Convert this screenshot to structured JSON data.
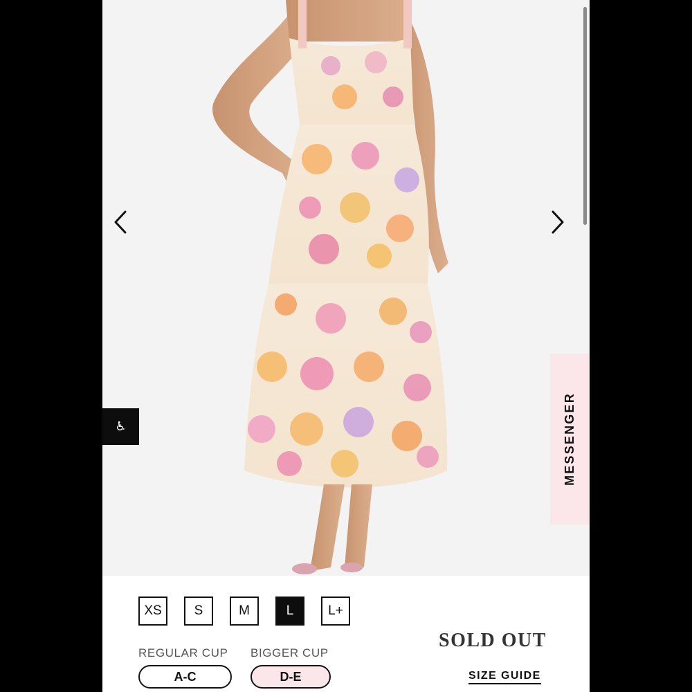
{
  "gallery": {
    "image_alt": "Floral midi dress",
    "prev_icon": "chevron-left-icon",
    "next_icon": "chevron-right-icon"
  },
  "accessibility": {
    "icon": "wheelchair-icon",
    "glyph": "♿"
  },
  "messenger": {
    "label": "MESSENGER"
  },
  "sizes": [
    {
      "label": "XS",
      "selected": false
    },
    {
      "label": "S",
      "selected": false
    },
    {
      "label": "M",
      "selected": false
    },
    {
      "label": "L",
      "selected": true
    },
    {
      "label": "L+",
      "selected": false
    }
  ],
  "cups": [
    {
      "heading": "REGULAR CUP",
      "value": "A-C",
      "selected": false
    },
    {
      "heading": "BIGGER CUP",
      "value": "D-E",
      "selected": true
    }
  ],
  "status": {
    "sold_out": "SOLD OUT",
    "size_guide": "SIZE GUIDE"
  },
  "colors": {
    "page_background": "#000000",
    "photo_background": "#f3f3f4",
    "messenger_background": "#fbe7ea",
    "selected_cup_background": "#fbe6ea",
    "selected_size_background": "#0d0d0d"
  }
}
